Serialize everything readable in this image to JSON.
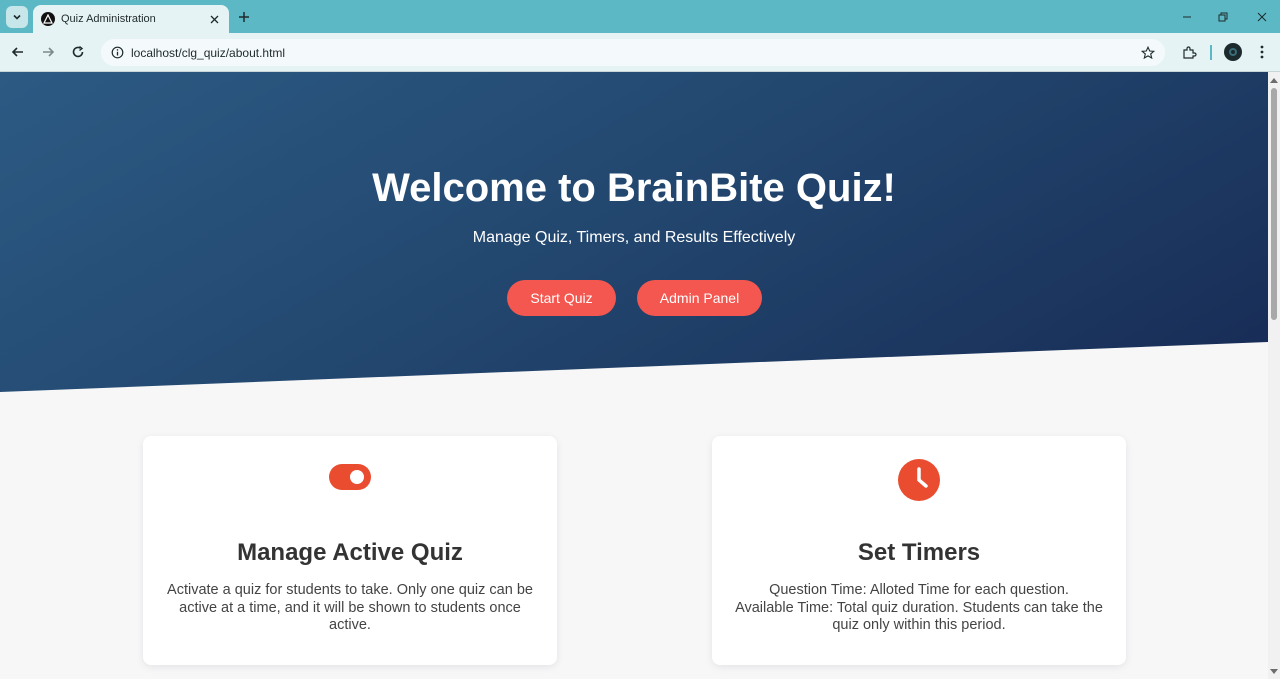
{
  "browser": {
    "tab_title": "Quiz Administration",
    "url": "localhost/clg_quiz/about.html"
  },
  "hero": {
    "title": "Welcome to BrainBite Quiz!",
    "subtitle": "Manage Quiz, Timers, and Results Effectively",
    "buttons": [
      {
        "label": "Start Quiz"
      },
      {
        "label": "Admin Panel"
      }
    ]
  },
  "features": [
    {
      "icon": "toggle-icon",
      "title": "Manage Active Quiz",
      "text": "Activate a quiz for students to take. Only one quiz can be active at a time, and it will be shown to students once active."
    },
    {
      "icon": "clock-icon",
      "title": "Set Timers",
      "text_line1": "Question Time: Alloted Time for each question.",
      "text_line2": "Available Time: Total quiz duration. Students can take the quiz only within this period."
    }
  ],
  "colors": {
    "accent": "#f4574f",
    "hero_start": "#2c5a83",
    "hero_end": "#172b55",
    "icon": "#ea4c2f"
  }
}
